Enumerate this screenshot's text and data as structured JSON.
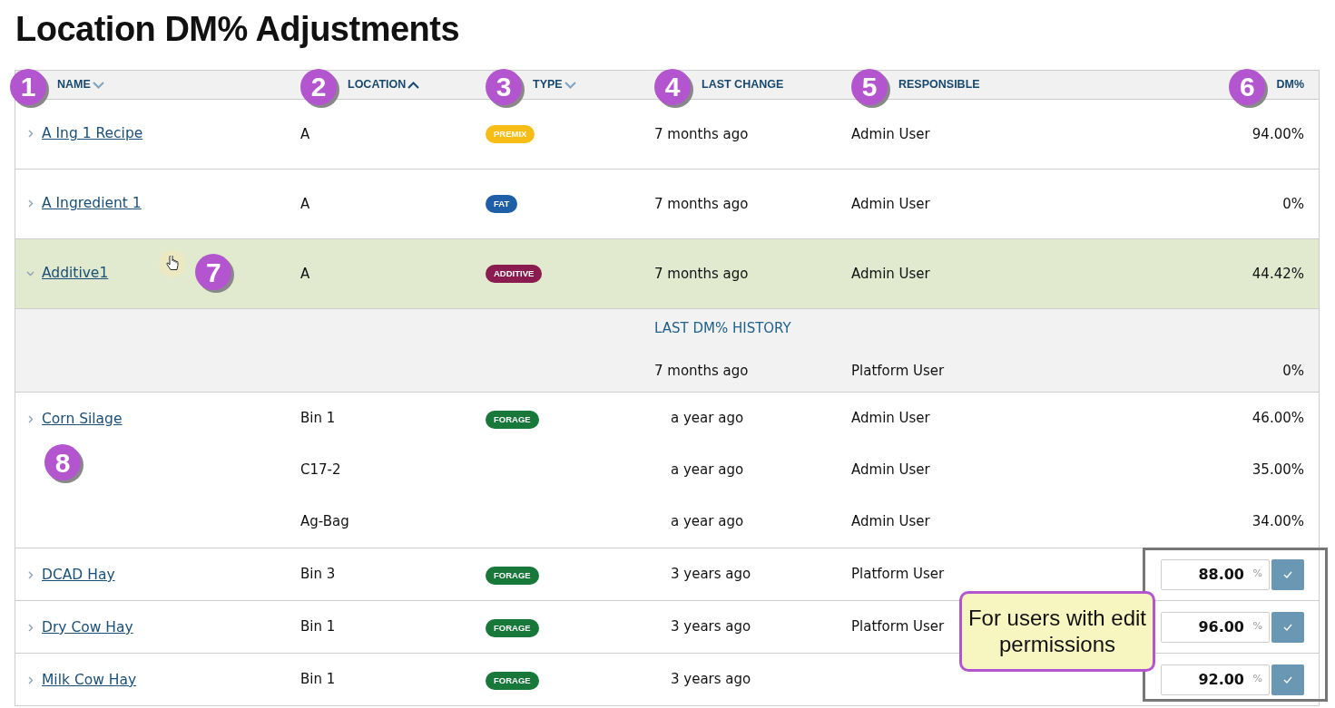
{
  "title": "Location DM% Adjustments",
  "columns": [
    {
      "label": "NAME",
      "sortable": true,
      "sorted_ascending": false,
      "callout": "1"
    },
    {
      "label": "LOCATION",
      "sortable": true,
      "sorted_ascending": true,
      "callout": "2"
    },
    {
      "label": "TYPE",
      "sortable": true,
      "sorted_ascending": false,
      "callout": "3"
    },
    {
      "label": "LAST CHANGE",
      "callout": "4"
    },
    {
      "label": "RESPONSIBLE",
      "callout": "5"
    },
    {
      "label": "DM%",
      "callout": "6"
    }
  ],
  "rows": [
    {
      "name": "A Ing 1 Recipe",
      "expanded": false,
      "hovered": false,
      "type": {
        "label": "PREMIX",
        "color": "#f6bd16"
      },
      "entries": [
        {
          "location": "A",
          "last_change": "7 months ago",
          "responsible": "Admin User",
          "dm": "94.00%"
        }
      ]
    },
    {
      "name": "A Ingredient 1",
      "expanded": false,
      "hovered": false,
      "type": {
        "label": "FAT",
        "color": "#1f5fa8"
      },
      "entries": [
        {
          "location": "A",
          "last_change": "7 months ago",
          "responsible": "Admin User",
          "dm": "0%"
        }
      ]
    },
    {
      "name": "Additive1",
      "expanded": true,
      "hovered": true,
      "callout": "7",
      "type": {
        "label": "ADDITIVE",
        "color": "#8a1c4f"
      },
      "entries": [
        {
          "location": "A",
          "last_change": "7 months ago",
          "responsible": "Admin User",
          "dm": "44.42%"
        }
      ],
      "history": {
        "heading": "LAST DM% HISTORY",
        "entries": [
          {
            "last_change": "7 months ago",
            "responsible": "Platform User",
            "dm": "0%"
          }
        ]
      }
    },
    {
      "name": "Corn Silage",
      "expanded": false,
      "hovered": false,
      "callout": "8",
      "type": {
        "label": "FORAGE",
        "color": "#17783a"
      },
      "entries": [
        {
          "location": "Bin 1",
          "last_change": "a year ago",
          "responsible": "Admin User",
          "dm": "46.00%"
        },
        {
          "location": "C17-2",
          "last_change": "a year ago",
          "responsible": "Admin User",
          "dm": "35.00%"
        },
        {
          "location": "Ag-Bag",
          "last_change": "a year ago",
          "responsible": "Admin User",
          "dm": "34.00%"
        }
      ]
    },
    {
      "name": "DCAD Hay",
      "expanded": false,
      "hovered": false,
      "type": {
        "label": "FORAGE",
        "color": "#17783a"
      },
      "entries": [
        {
          "location": "Bin 3",
          "last_change": "3 years ago",
          "responsible": "Platform User",
          "dm_input": "88.00",
          "unit": "%"
        }
      ]
    },
    {
      "name": "Dry Cow Hay",
      "expanded": false,
      "hovered": false,
      "type": {
        "label": "FORAGE",
        "color": "#17783a"
      },
      "entries": [
        {
          "location": "Bin 1",
          "last_change": "3 years ago",
          "responsible": "Platform User",
          "dm_input": "96.00",
          "unit": "%"
        }
      ]
    },
    {
      "name": "Milk Cow Hay",
      "expanded": false,
      "hovered": false,
      "type": {
        "label": "FORAGE",
        "color": "#17783a"
      },
      "entries": [
        {
          "location": "Bin 1",
          "last_change": "3 years ago",
          "dm_input": "92.00",
          "unit": "%"
        }
      ]
    }
  ],
  "edit_note": "For users with edit permissions"
}
